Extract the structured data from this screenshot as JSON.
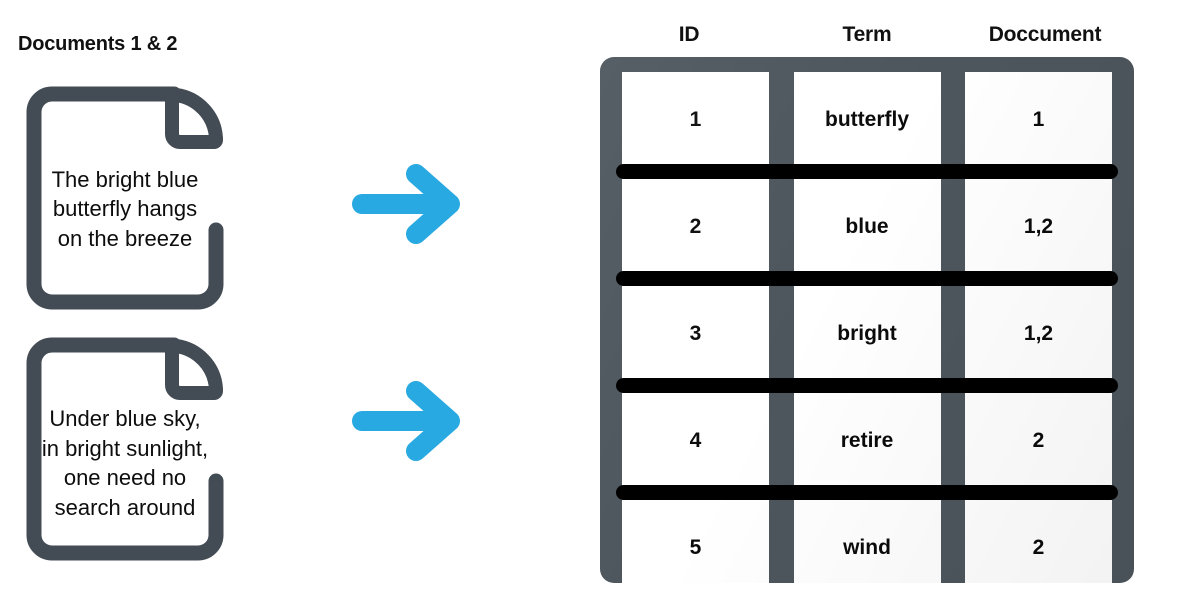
{
  "left_panel": {
    "title": "Documents 1 & 2",
    "documents": [
      {
        "id": 1,
        "text": "The bright blue butterfly hangs on the breeze"
      },
      {
        "id": 2,
        "text": "Under blue sky, in bright sunlight, one need no search around"
      }
    ]
  },
  "arrows": [
    {
      "name": "arrow-doc1-to-index",
      "direction": "right"
    },
    {
      "name": "arrow-doc2-to-index",
      "direction": "right"
    }
  ],
  "table": {
    "headers": [
      "ID",
      "Term",
      "Doccument"
    ],
    "rows": [
      {
        "id": "1",
        "term": "butterfly",
        "document": "1"
      },
      {
        "id": "2",
        "term": "blue",
        "document": "1,2"
      },
      {
        "id": "3",
        "term": "bright",
        "document": "1,2"
      },
      {
        "id": "4",
        "term": "retire",
        "document": "2"
      },
      {
        "id": "5",
        "term": "wind",
        "document": "2"
      }
    ]
  },
  "colors": {
    "arrow_blue": "#29a9e1",
    "outline_slate": "#434b54",
    "frame_slate": "#4d565d",
    "separator_black": "#000000",
    "cell_white": "#ffffff",
    "text_black": "#0b0b0b",
    "background": "#ffffff"
  }
}
